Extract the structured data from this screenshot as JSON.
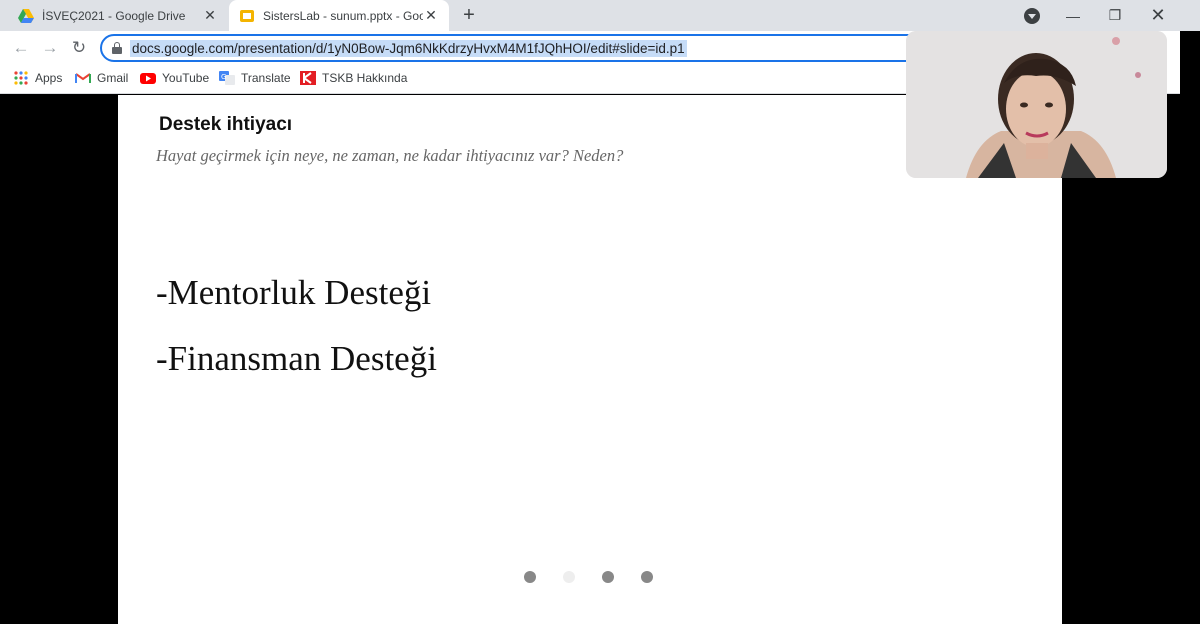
{
  "browser": {
    "tabs": [
      {
        "title": "İSVEÇ2021 - Google Drive",
        "icon": "google-drive-icon",
        "active": false
      },
      {
        "title": "SistersLab - sunum.pptx - Google",
        "icon": "google-slides-icon",
        "active": true
      }
    ],
    "url": "docs.google.com/presentation/d/1yN0Bow-Jqm6NkKdrzyHvxM4M1fJQhHOI/edit#slide=id.p1",
    "bookmarks": [
      {
        "label": "Apps",
        "icon": "apps-grid-icon"
      },
      {
        "label": "Gmail",
        "icon": "gmail-icon"
      },
      {
        "label": "YouTube",
        "icon": "youtube-icon"
      },
      {
        "label": "Translate",
        "icon": "translate-icon"
      },
      {
        "label": "TSKB Hakkında",
        "icon": "tskb-icon"
      }
    ]
  },
  "slide": {
    "heading": "Destek ihtiyacı",
    "subtitle": "Hayat geçirmek için neye, ne zaman, ne kadar ihtiyacınız var? Neden?",
    "items": [
      "-Mentorluk Desteği",
      "-Finansman Desteği"
    ],
    "page_indicator": {
      "count": 4,
      "light_index": 1
    }
  },
  "colors": {
    "accent": "#1a73e8",
    "tab_strip": "#dee1e6",
    "url_highlight": "#c6dcf7"
  }
}
